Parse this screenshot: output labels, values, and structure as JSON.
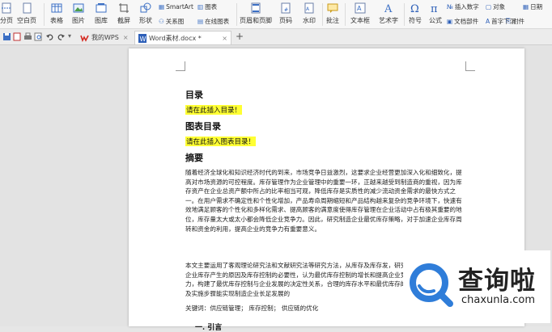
{
  "ribbon": {
    "items": [
      {
        "label": "分页",
        "icon": "page-break-icon"
      },
      {
        "label": "空白页",
        "icon": "blank-page-icon"
      },
      {
        "label": "表格",
        "icon": "table-icon"
      },
      {
        "label": "图片",
        "icon": "picture-icon"
      },
      {
        "label": "图库",
        "icon": "gallery-icon"
      },
      {
        "label": "截屏",
        "icon": "screenshot-icon"
      },
      {
        "label": "形状",
        "icon": "shape-icon"
      },
      {
        "label": "页眉和页脚",
        "icon": "header-footer-icon"
      },
      {
        "label": "页码",
        "icon": "page-number-icon"
      },
      {
        "label": "水印",
        "icon": "watermark-icon"
      },
      {
        "label": "批注",
        "icon": "comment-icon"
      },
      {
        "label": "文本框",
        "icon": "textbox-icon"
      },
      {
        "label": "艺术字",
        "icon": "wordart-icon"
      },
      {
        "label": "符号",
        "icon": "omega-icon"
      },
      {
        "label": "公式",
        "icon": "pi-icon"
      }
    ],
    "smartart": "SmartArt",
    "chart": "图表",
    "relation": "关系图",
    "online_chart": "在线图表",
    "insert_number": "插入数字",
    "object": "对象",
    "date": "日期",
    "attachment": "附件",
    "document_parts": "文档部件",
    "first_letter_sink": "首字下沉"
  },
  "tabs": {
    "wps_tab": "我的WPS",
    "doc_tab": "Word素材.docx *",
    "add": "+"
  },
  "document": {
    "toc_heading": "目录",
    "toc_placeholder": "请在此插入目录！",
    "figure_toc_heading": "图表目录",
    "figure_toc_placeholder": "请在此插入图表目录！",
    "abstract_heading": "摘要",
    "abstract_para": "随着经济全球化和知识经济时代的到来，市场竞争日益激烈，这要求企业经营更加深入化和细致化，提高对市场资源的可控程度。库存管理作为企业管理中的重要一环，正越来越受到制造商的重视，因为库存资产在企业总资产额中所占的比率相当可观，降低库存是实质性的减少流动资金需求的最快方式之一。在用户需求不确定性和个性化增加，产品寿命周期缩短和产品结构越来复杂的竞争环境下，快速有效地满足顾客的个性化和多样化需求、提高顾客的满意度使得库存管理在企业活动中占有极其重要的地位，库存量太大或太小都会降低企业竞争力。因此，研究制造企业最优库存策略，对于加速企业库存周转和资金的利用，提高企业的竞争力有重要意义。",
    "body_para": "本文主要运用了客观理论研究法和文献研究法等研究方法，从库存及库存发，研究制造企业库存产生的原因及库存控制的必要性，认为最优库存控制的增长和提高企业竞争力，构建了最优库存控制与企业发展的决定性关系，合理的库存水平和最优库存的目标及实施步骤能实现制造企业长足发展的",
    "keywords": "关键词：供应链管理； 库存控制； 供应链的优化",
    "next_heading": "一. 引言"
  },
  "watermark": {
    "cn_text": "查询啦",
    "url": "chaxunla.com"
  },
  "colors": {
    "highlight": "#ffff33",
    "wps_red": "#d42b22",
    "watermark_blue": "#2f7dd9"
  }
}
